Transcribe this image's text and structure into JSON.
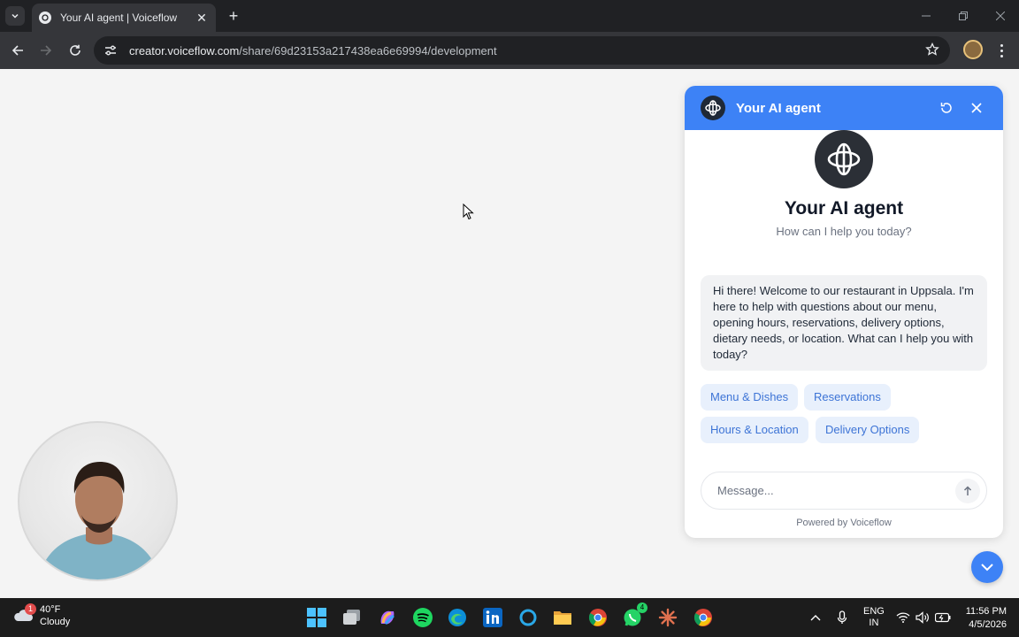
{
  "browser": {
    "tab": {
      "title": "Your AI agent | Voiceflow"
    },
    "url": {
      "host": "creator.voiceflow.com",
      "path": "/share/69d23153a217438ea6e69994/development"
    }
  },
  "chat": {
    "header_title": "Your AI agent",
    "agent_name": "Your AI agent",
    "agent_subtitle": "How can I help you today?",
    "welcome_message": "Hi there! Welcome to our restaurant in Uppsala. I'm here to help with questions about our menu, opening hours, reservations, delivery options, dietary needs, or location. What can I help you with today?",
    "quick_replies": [
      "Menu & Dishes",
      "Reservations",
      "Hours & Location",
      "Delivery Options"
    ],
    "composer_placeholder": "Message...",
    "powered_by": "Powered by Voiceflow",
    "accent_color": "#3d82f6"
  },
  "taskbar": {
    "weather": {
      "temp": "40°F",
      "condition": "Cloudy",
      "badge": "1"
    },
    "apps": [
      "windows-start",
      "task-view",
      "copilot",
      "spotify",
      "edge",
      "linkedin",
      "cortana",
      "file-explorer",
      "chrome",
      "whatsapp",
      "claude",
      "chrome-profile"
    ],
    "whatsapp_badge": "4",
    "language": {
      "lang": "ENG",
      "region": "IN"
    },
    "time": "11:56 PM",
    "date": "4/5/2026"
  }
}
